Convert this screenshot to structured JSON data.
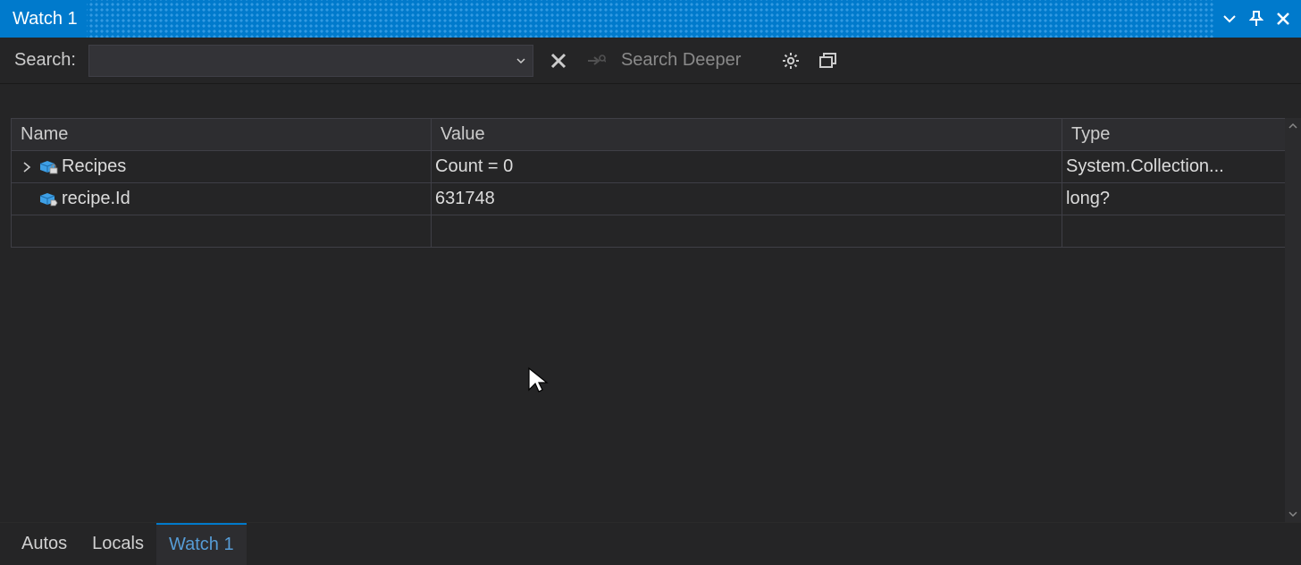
{
  "title": "Watch 1",
  "toolbar": {
    "search_label": "Search:",
    "search_value": "",
    "search_placeholder": "",
    "search_deeper": "Search Deeper"
  },
  "columns": {
    "name": "Name",
    "value": "Value",
    "type": "Type"
  },
  "rows": [
    {
      "expandable": true,
      "icon": "lock",
      "name": "Recipes",
      "value": "Count = 0",
      "type": "System.Collection..."
    },
    {
      "expandable": false,
      "icon": "tag",
      "name": "recipe.Id",
      "value": "631748",
      "type": "long?"
    }
  ],
  "tabs": [
    {
      "label": "Autos",
      "active": false
    },
    {
      "label": "Locals",
      "active": false
    },
    {
      "label": "Watch 1",
      "active": true
    }
  ]
}
